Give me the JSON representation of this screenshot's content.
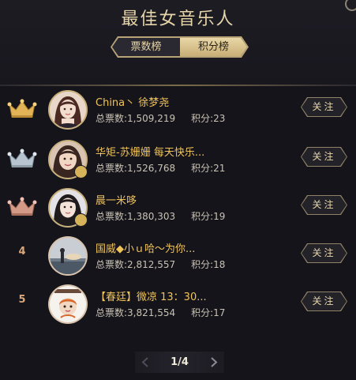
{
  "header": {
    "title": "最佳女音乐人",
    "tabs": [
      {
        "label": "票数榜",
        "active": false
      },
      {
        "label": "积分榜",
        "active": true
      }
    ]
  },
  "ranking": {
    "votes_label": "总票数:",
    "points_label": "积分:",
    "follow_label": "关注",
    "items": [
      {
        "rank": "1",
        "rank_style": "gold-crown",
        "name": "China丶 徐梦尧",
        "votes": "1,509,219",
        "points": "23",
        "avatar": "avatar-girl-anime"
      },
      {
        "rank": "2",
        "rank_style": "silver-crown",
        "name": "华矩-苏姗姗 每天快乐...",
        "votes": "1,526,768",
        "points": "21",
        "avatar": "avatar-girl-photo"
      },
      {
        "rank": "3",
        "rank_style": "bronze-crown",
        "name": "晨一米哆",
        "votes": "1,380,303",
        "points": "19",
        "avatar": "avatar-girl-photo"
      },
      {
        "rank": "4",
        "rank_style": "number",
        "name": "国威◆小ｕ哈～为你...",
        "votes": "2,812,557",
        "points": "18",
        "avatar": "avatar-sea-sunset"
      },
      {
        "rank": "5",
        "rank_style": "number",
        "name": "【春廷】微凉 13：30...",
        "votes": "3,821,554",
        "points": "17",
        "avatar": "avatar-cartoon"
      }
    ]
  },
  "pagination": {
    "indicator": "1/4"
  },
  "colors": {
    "background": "#15141b",
    "accent_gold": "#e6d5a9",
    "name_gold": "#f0c45a",
    "rank_number": "#d9a87a"
  }
}
